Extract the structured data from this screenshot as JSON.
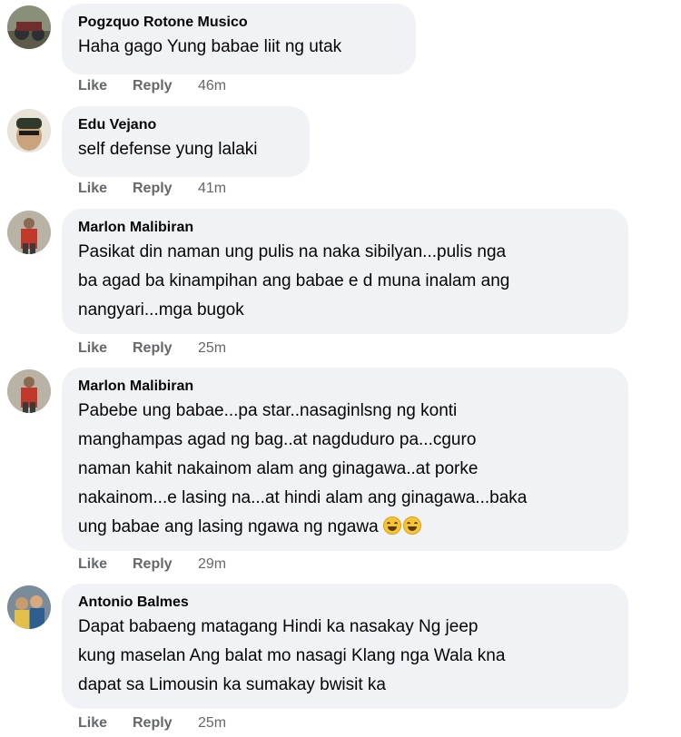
{
  "comments": [
    {
      "author": "Pogzquo Rotone Musico",
      "lines": [
        "Haha gago Yung babae liit ng utak"
      ],
      "like": "Like",
      "reply": "Reply",
      "time": "46m",
      "avatar_icon": "user-photo-icon"
    },
    {
      "author": "Edu Vejano",
      "lines": [
        "self defense yung lalaki"
      ],
      "like": "Like",
      "reply": "Reply",
      "time": "41m",
      "avatar_icon": "user-photo-icon"
    },
    {
      "author": "Marlon Malibiran",
      "lines": [
        "Pasikat din naman ung pulis na naka sibilyan...pulis nga",
        "ba agad ba kinampihan ang babae e d muna inalam ang",
        "nangyari...mga bugok"
      ],
      "like": "Like",
      "reply": "Reply",
      "time": "25m",
      "avatar_icon": "user-photo-icon"
    },
    {
      "author": "Marlon Malibiran",
      "lines": [
        "Pabebe ung babae...pa star..nasaginlsng ng konti",
        "manghampas agad ng bag..at nagduduro pa...cguro",
        "naman kahit nakainom alam ang ginagawa..at porke",
        "nakainom...e lasing na...at hindi alam ang ginagawa...baka",
        "ung babae ang lasing ngawa ng ngawa"
      ],
      "emoji": [
        "rolling-laughing-emoji-icon",
        "rolling-laughing-emoji-icon"
      ],
      "like": "Like",
      "reply": "Reply",
      "time": "29m",
      "avatar_icon": "user-photo-icon"
    },
    {
      "author": "Antonio Balmes",
      "lines": [
        "Dapat babaeng matagang Hindi ka nasakay Ng jeep",
        "kung maselan Ang balat mo nasagi Klang nga Wala kna",
        "dapat sa Limousin ka sumakay bwisit ka"
      ],
      "like": "Like",
      "reply": "Reply",
      "time": "25m",
      "avatar_icon": "user-photo-icon"
    }
  ]
}
